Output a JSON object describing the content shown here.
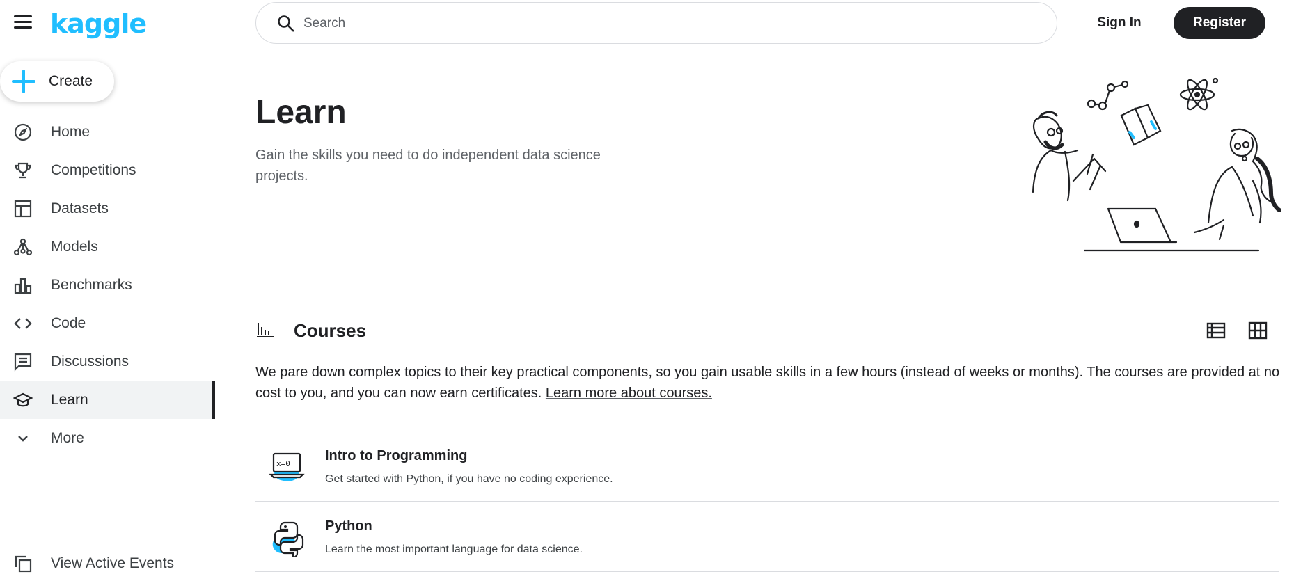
{
  "brand": {
    "logo_text": "kaggle",
    "accent_color": "#20beff"
  },
  "sidebar": {
    "menu_icon": "hamburger-menu-icon",
    "create_label": "Create",
    "items": [
      {
        "label": "Home",
        "icon": "compass-icon"
      },
      {
        "label": "Competitions",
        "icon": "trophy-icon"
      },
      {
        "label": "Datasets",
        "icon": "table-icon"
      },
      {
        "label": "Models",
        "icon": "models-icon"
      },
      {
        "label": "Benchmarks",
        "icon": "bar-chart-icon"
      },
      {
        "label": "Code",
        "icon": "code-icon"
      },
      {
        "label": "Discussions",
        "icon": "comment-icon"
      },
      {
        "label": "Learn",
        "icon": "graduation-cap-icon",
        "active": true
      },
      {
        "label": "More",
        "icon": "chevron-down-icon"
      }
    ],
    "bottom_link": "View Active Events"
  },
  "header": {
    "search_placeholder": "Search",
    "signin_label": "Sign In",
    "register_label": "Register"
  },
  "hero": {
    "title": "Learn",
    "subtitle": "Gain the skills you need to do independent data science projects."
  },
  "courses": {
    "title": "Courses",
    "description": "We pare down complex topics to their key practical components, so you gain usable skills in a few hours (instead of weeks or months). The courses are provided at no cost to you, and you can now earn certificates.",
    "link_label": "Learn more about courses.",
    "items": [
      {
        "title": "Intro to Programming",
        "description": "Get started with Python, if you have no coding experience.",
        "icon": "laptop-icon"
      },
      {
        "title": "Python",
        "description": "Learn the most important language for data science.",
        "icon": "python-icon"
      }
    ]
  }
}
